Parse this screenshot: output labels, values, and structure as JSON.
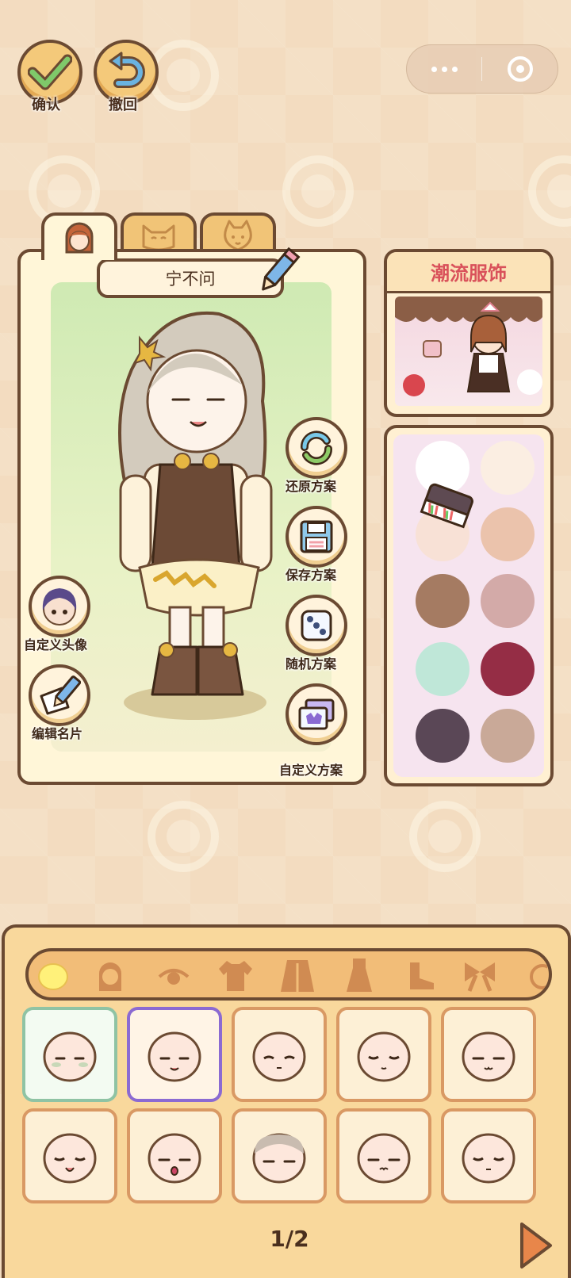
{
  "toolbar": {
    "confirm_label": "确认",
    "undo_label": "撤回"
  },
  "capsule": {
    "menu_icon": "more-dots-icon",
    "close_icon": "target-close-icon"
  },
  "tabs": [
    {
      "icon": "girl-face-icon",
      "active": true
    },
    {
      "icon": "cat-face-icon",
      "active": false
    },
    {
      "icon": "dog-face-icon",
      "active": false
    }
  ],
  "character": {
    "name": "宁不问"
  },
  "actions": {
    "restore_label": "还原方案",
    "save_label": "保存方案",
    "random_label": "随机方案",
    "custom_plan_label": "自定义方案",
    "custom_avatar_label": "自定义头像",
    "edit_card_label": "编辑名片"
  },
  "fashion": {
    "title": "潮流服饰"
  },
  "palette": {
    "swatches": [
      "#ffffff",
      "#fbeee2",
      "#f8e1d6",
      "#ebc3ac",
      "#a57b62",
      "#d3aaa8",
      "#bfe7d8",
      "#952d45",
      "#5a4756",
      "#c9a998"
    ]
  },
  "categories": [
    "face-icon",
    "hair-icon",
    "eye-icon",
    "top-icon",
    "coat-icon",
    "dress-icon",
    "shoes-icon",
    "bow-icon"
  ],
  "faces": {
    "count": 10,
    "selected_green": 0,
    "selected_purple": 1
  },
  "pager": {
    "text": "1/2"
  },
  "colors": {
    "outline": "#6b4a32",
    "accent_red": "#d9515a",
    "panel": "#fff6d8",
    "button_gold": "#f4c97a"
  }
}
